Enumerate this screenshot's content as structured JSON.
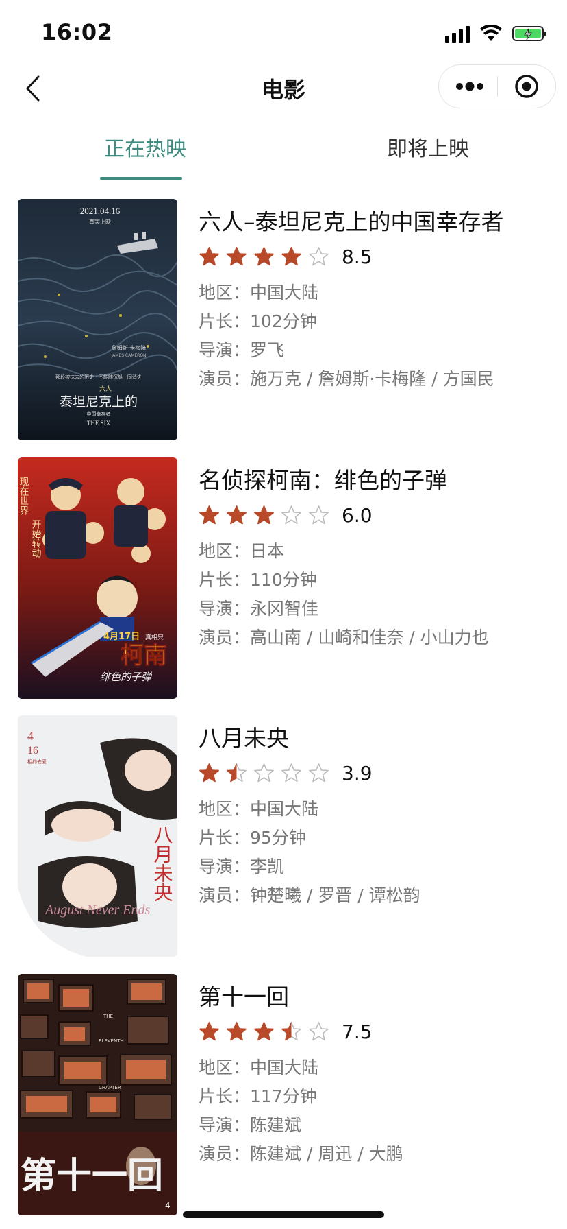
{
  "status_bar": {
    "time": "16:02"
  },
  "nav": {
    "title": "电影"
  },
  "tabs": [
    {
      "label": "正在热映"
    },
    {
      "label": "即将上映"
    }
  ],
  "labels": {
    "region": "地区：",
    "length": "片长：",
    "director": "导演：",
    "actors": "演员："
  },
  "colors": {
    "accent": "#3f8a7e",
    "star": "#b84a2a",
    "star_empty": "#bbbbbb"
  },
  "movies": [
    {
      "title": "六人–泰坦尼克上的中国幸存者",
      "rating": 4,
      "score": "8.5",
      "region": "中国大陆",
      "length": "102分钟",
      "director": "罗飞",
      "actors": "施万克 / 詹姆斯·卡梅隆 / 方国民",
      "poster": {
        "date": "2021.04.16",
        "date_sub": "真実上映",
        "tagline": "那段被抹去的历史 · 不能随沉船一同消失",
        "title_small": "六人",
        "title_main": "泰坦尼克上的",
        "title_sub": "中国幸存者",
        "title_en": "THE SIX",
        "credit_cn": "詹姆斯·卡梅隆",
        "credit_en": "JAMES CAMERON"
      }
    },
    {
      "title": "名侦探柯南：绯色的子弹",
      "rating": 3,
      "score": "6.0",
      "region": "日本",
      "length": "110分钟",
      "director": "永冈智佳",
      "actors": "高山南 / 山崎和佳奈 / 小山力也",
      "poster": {
        "vertical_text_1": "现在世界",
        "vertical_text_2": "开始转动",
        "date": "4月17日",
        "date_tag": "真相只",
        "title_big": "柯南",
        "title_sub": "绯色的子弹"
      }
    },
    {
      "title": "八月未央",
      "rating": 1.5,
      "score": "3.9",
      "region": "中国大陆",
      "length": "95分钟",
      "director": "李凯",
      "actors": "钟楚曦 / 罗晋 / 谭松韵",
      "poster": {
        "date_month": "4",
        "date_day": "16",
        "date_tag": "相约去爱",
        "title_v": "八月未央",
        "title_en": "August Never Ends"
      }
    },
    {
      "title": "第十一回",
      "rating": 3.5,
      "score": "7.5",
      "region": "中国大陆",
      "length": "117分钟",
      "director": "陈建斌",
      "actors": "陈建斌 / 周迅 / 大鹏",
      "poster": {
        "title_big": "第十一回",
        "title_en_1": "THE",
        "title_en_2": "ELEVENTH",
        "title_en_3": "CHAPTER",
        "date": "4"
      }
    }
  ]
}
